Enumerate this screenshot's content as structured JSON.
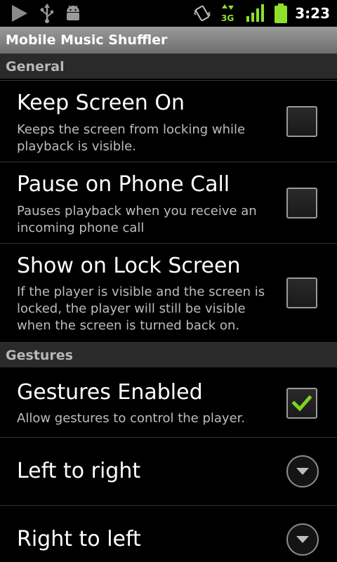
{
  "status_bar": {
    "time": "3:23",
    "network": "3G"
  },
  "app": {
    "title": "Mobile Music Shuffler"
  },
  "sections": {
    "general": "General",
    "gestures": "Gestures"
  },
  "prefs": {
    "keep_screen_on": {
      "title": "Keep Screen On",
      "summary": "Keeps the screen from locking while playback is visible.",
      "checked": false
    },
    "pause_on_call": {
      "title": "Pause on Phone Call",
      "summary": "Pauses playback when you receive an incoming phone call",
      "checked": false
    },
    "show_on_lock": {
      "title": "Show on Lock Screen",
      "summary": "If the player is visible and the screen is locked, the player will still be visible when the screen is turned back on.",
      "checked": false
    },
    "gestures_enabled": {
      "title": "Gestures Enabled",
      "summary": "Allow gestures to control the player.",
      "checked": true
    },
    "left_to_right": {
      "title": "Left to right"
    },
    "right_to_left": {
      "title": "Right to left"
    }
  },
  "colors": {
    "checkmark": "#7ed321",
    "battery": "#8ee02b",
    "signal": "#8ee02b"
  }
}
